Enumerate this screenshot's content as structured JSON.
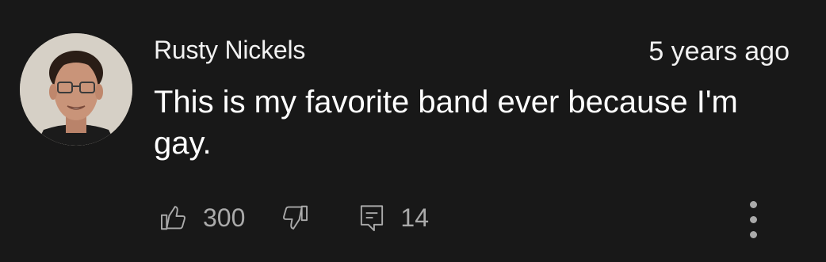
{
  "comment": {
    "author": "Rusty Nickels",
    "timestamp": "5 years ago",
    "text": "This is my favorite band ever because I'm gay.",
    "likes": "300",
    "replies": "14"
  },
  "icons": {
    "like": "thumbs-up-icon",
    "dislike": "thumbs-down-icon",
    "reply": "reply-comment-icon",
    "more": "more-vertical-icon"
  },
  "colors": {
    "background": "#181818",
    "text_primary": "#ffffff",
    "text_secondary": "#aaaaaa"
  }
}
